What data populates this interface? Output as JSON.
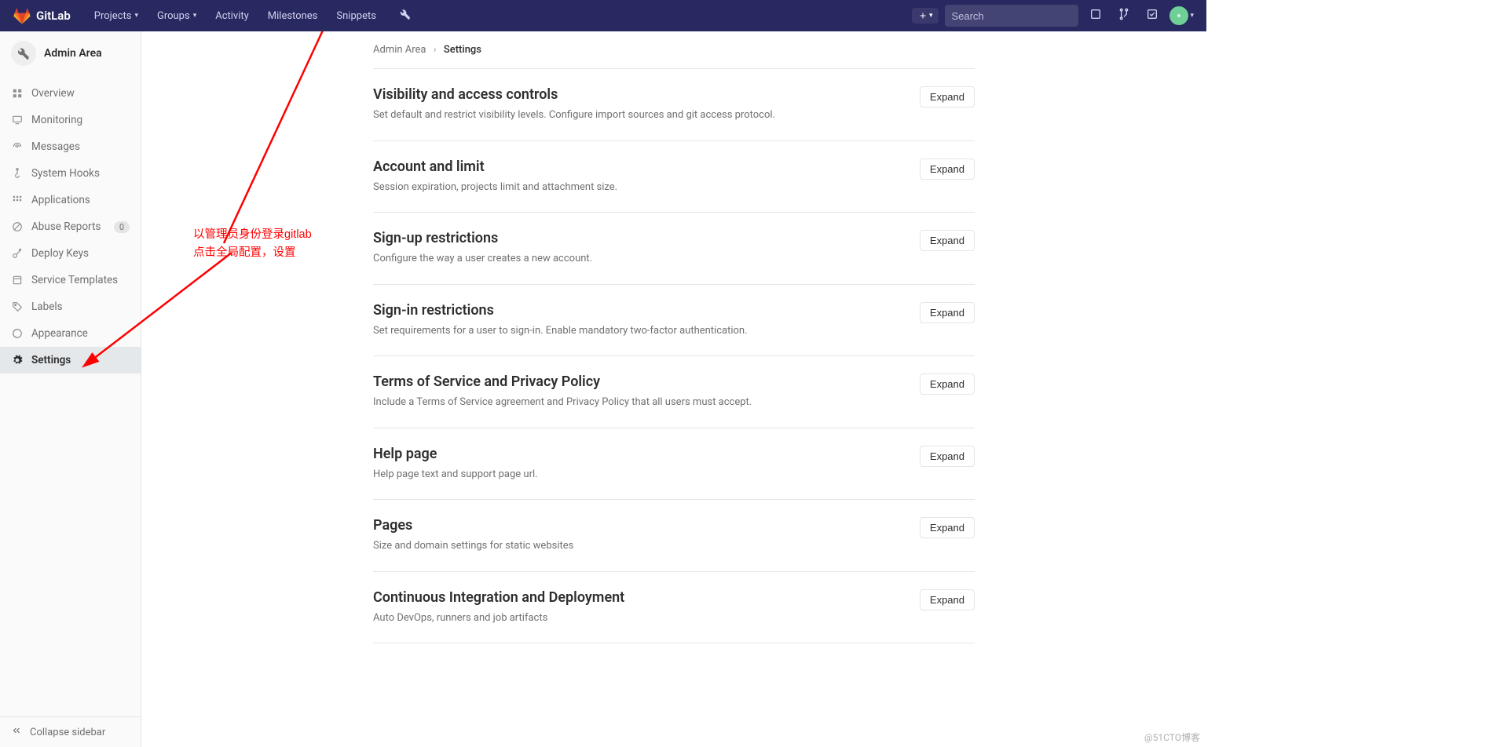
{
  "navbar": {
    "brand": "GitLab",
    "links": {
      "projects": "Projects",
      "groups": "Groups",
      "activity": "Activity",
      "milestones": "Milestones",
      "snippets": "Snippets"
    },
    "search_placeholder": "Search"
  },
  "sidebar": {
    "context_title": "Admin Area",
    "items": {
      "overview": "Overview",
      "monitoring": "Monitoring",
      "messages": "Messages",
      "system_hooks": "System Hooks",
      "applications": "Applications",
      "abuse_reports": "Abuse Reports",
      "abuse_badge": "0",
      "deploy_keys": "Deploy Keys",
      "service_templates": "Service Templates",
      "labels": "Labels",
      "appearance": "Appearance",
      "settings": "Settings"
    },
    "collapse": "Collapse sidebar"
  },
  "breadcrumb": {
    "admin": "Admin Area",
    "current": "Settings"
  },
  "sections": [
    {
      "title": "Visibility and access controls",
      "desc": "Set default and restrict visibility levels. Configure import sources and git access protocol.",
      "expand": "Expand"
    },
    {
      "title": "Account and limit",
      "desc": "Session expiration, projects limit and attachment size.",
      "expand": "Expand"
    },
    {
      "title": "Sign-up restrictions",
      "desc": "Configure the way a user creates a new account.",
      "expand": "Expand"
    },
    {
      "title": "Sign-in restrictions",
      "desc": "Set requirements for a user to sign-in. Enable mandatory two-factor authentication.",
      "expand": "Expand"
    },
    {
      "title": "Terms of Service and Privacy Policy",
      "desc": "Include a Terms of Service agreement and Privacy Policy that all users must accept.",
      "expand": "Expand"
    },
    {
      "title": "Help page",
      "desc": "Help page text and support page url.",
      "expand": "Expand"
    },
    {
      "title": "Pages",
      "desc": "Size and domain settings for static websites",
      "expand": "Expand"
    },
    {
      "title": "Continuous Integration and Deployment",
      "desc": "Auto DevOps, runners and job artifacts",
      "expand": "Expand"
    }
  ],
  "annotation": {
    "line1": "以管理员身份登录gitlab",
    "line2": "点击全局配置，设置"
  },
  "watermark": "@51CTO博客"
}
